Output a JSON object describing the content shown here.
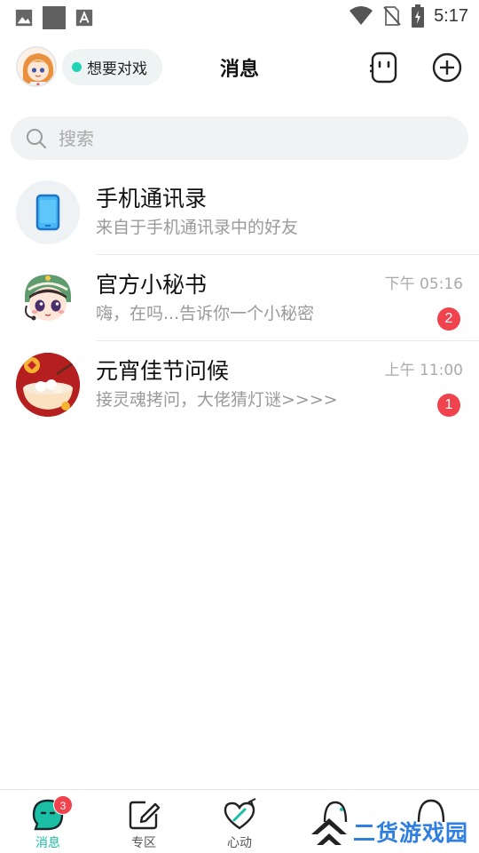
{
  "status_bar": {
    "time": "5:17",
    "left_icons": [
      "image-icon",
      "square-icon",
      "a-font-icon"
    ],
    "right_icons": [
      "wifi-icon",
      "no-sim-icon",
      "battery-charging-icon"
    ]
  },
  "header": {
    "title": "消息",
    "status_text": "想要对戏",
    "status_color": "#1ed3b6"
  },
  "search": {
    "placeholder": "搜索"
  },
  "conversations": [
    {
      "name": "手机通讯录",
      "preview": "来自于手机通讯录中的好友",
      "time": "",
      "badge": ""
    },
    {
      "name": "官方小秘书",
      "preview": "嗨，在吗...告诉你一个小秘密",
      "time": "下午 05:16",
      "badge": "2"
    },
    {
      "name": "元宵佳节问候",
      "preview": "接灵魂拷问，大佬猜灯谜>>>>",
      "time": "上午 11:00",
      "badge": "1"
    }
  ],
  "bottom_nav": {
    "items": [
      {
        "label": "消息",
        "badge": "3",
        "icon": "chat-bubble-icon"
      },
      {
        "label": "专区",
        "icon": "edit-square-icon"
      },
      {
        "label": "心动",
        "icon": "heart-arrow-icon"
      }
    ]
  },
  "watermark": {
    "text": "二货游戏园"
  },
  "colors": {
    "accent": "#1bbfa6",
    "badge": "#f0434e",
    "muted_text": "#9a9a9a"
  }
}
